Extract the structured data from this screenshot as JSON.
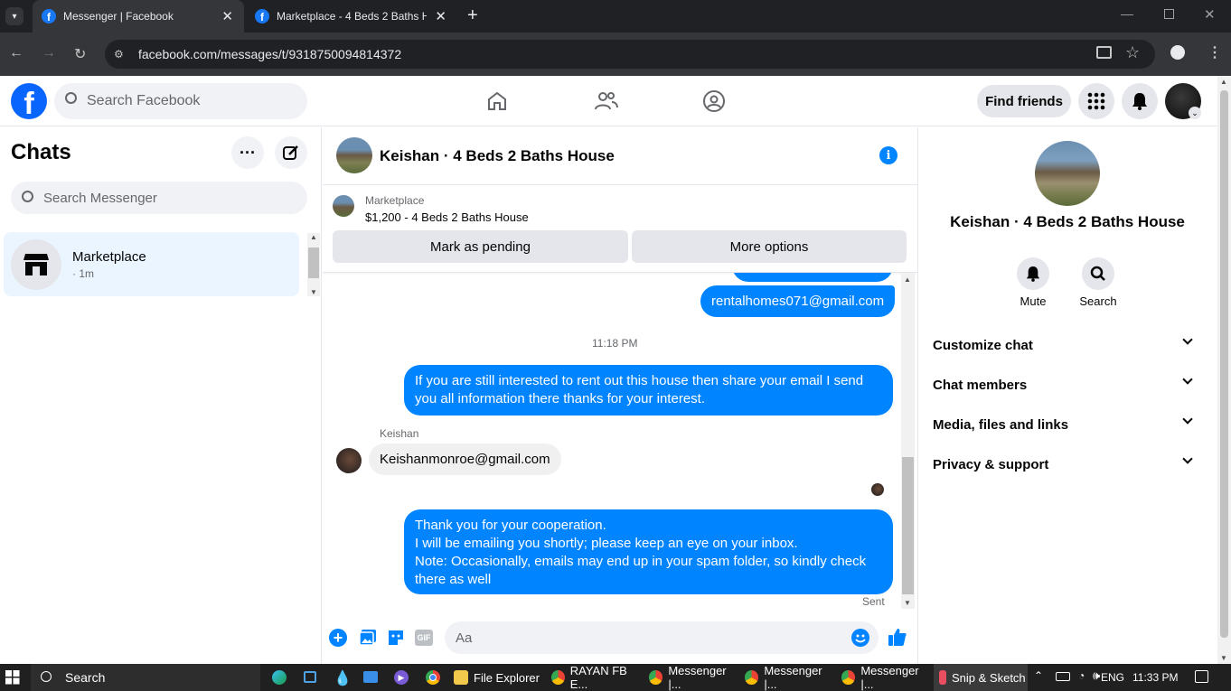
{
  "browser": {
    "tabs": [
      {
        "title": "Messenger | Facebook",
        "active": true
      },
      {
        "title": "Marketplace - 4 Beds 2 Baths H",
        "active": false
      }
    ],
    "url": "facebook.com/messages/t/9318750094814372"
  },
  "facebook_header": {
    "search_placeholder": "Search Facebook",
    "find_friends": "Find friends"
  },
  "chats_panel": {
    "title": "Chats",
    "search_placeholder": "Search Messenger",
    "items": [
      {
        "name": "Marketplace",
        "time": "· 1m"
      }
    ]
  },
  "conversation": {
    "title": "Keishan · 4 Beds 2 Baths House",
    "marketplace_label": "Marketplace",
    "listing": "$1,200 - 4 Beds 2 Baths House",
    "mark_pending": "Mark as pending",
    "more_options": "More options",
    "messages": [
      {
        "type": "out",
        "text": "rentalhomes071@gmail.com"
      },
      {
        "type": "timestamp",
        "text": "11:18 PM"
      },
      {
        "type": "out",
        "text": "If you are still interested to rent out this house then share your email  I send you all information there thanks for your interest."
      },
      {
        "type": "sender",
        "text": "Keishan"
      },
      {
        "type": "in",
        "text": "Keishanmonroe@gmail.com"
      },
      {
        "type": "out",
        "lines": [
          "Thank you for your cooperation.",
          "I will be emailing you shortly; please keep an eye on your inbox.",
          "Note: Occasionally, emails may end up in your spam folder, so kindly check there as well"
        ]
      },
      {
        "type": "status",
        "text": "Sent"
      }
    ],
    "composer_placeholder": "Aa"
  },
  "info_panel": {
    "title": "Keishan · 4 Beds 2 Baths House",
    "actions": [
      {
        "label": "Mute",
        "icon": "bell-icon"
      },
      {
        "label": "Search",
        "icon": "search-icon"
      }
    ],
    "sections": [
      "Customize chat",
      "Chat members",
      "Media, files and links",
      "Privacy & support"
    ]
  },
  "taskbar": {
    "search": "Search",
    "apps": [
      "File Explorer",
      "RAYAN FB E...",
      "Messenger |...",
      "Messenger |...",
      "Messenger |...",
      "Snip & Sketch"
    ],
    "language": "ENG",
    "time": "11:33 PM"
  },
  "colors": {
    "brand": "#0866ff",
    "bubble_out": "#0084ff",
    "bubble_in": "#f0f0f0"
  }
}
